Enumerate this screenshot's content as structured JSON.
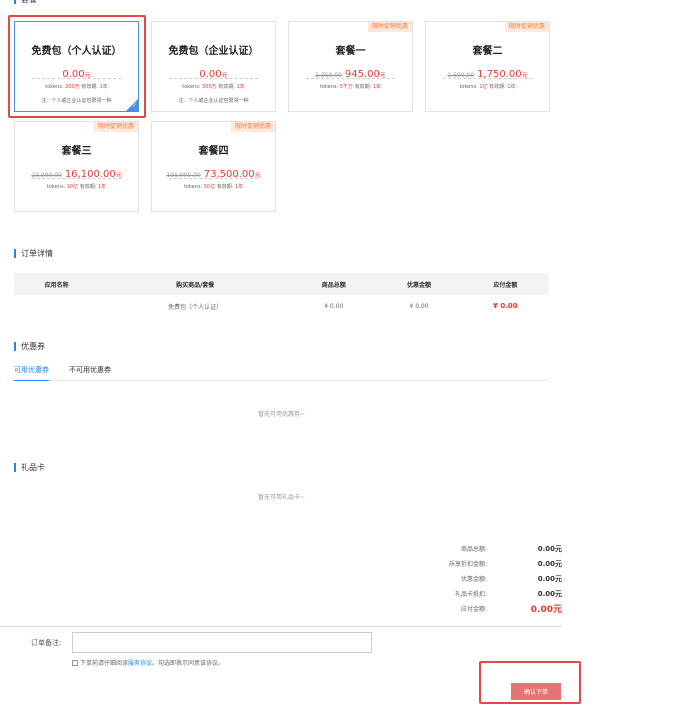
{
  "packages_section": {
    "title": "套餐"
  },
  "packages": [
    {
      "name": "免费包（个人认证）",
      "old_price": "",
      "price": "0.00",
      "unit": "元",
      "tokens_label": "tokens:",
      "tokens": "200万",
      "validity_label": "有效期:",
      "validity": "1年",
      "note": "注：个人或企业认证包限领一种",
      "promo": "",
      "selected": true
    },
    {
      "name": "免费包（企业认证）",
      "old_price": "",
      "price": "0.00",
      "unit": "元",
      "tokens_label": "tokens:",
      "tokens": "500万",
      "validity_label": "有效期:",
      "validity": "1年",
      "note": "注：个人或企业认证包限领一种",
      "promo": "",
      "selected": false
    },
    {
      "name": "套餐一",
      "old_price": "1,350.00",
      "price": "945.00",
      "unit": "元",
      "tokens_label": "tokens:",
      "tokens": "5千万",
      "validity_label": "有效期:",
      "validity": "1年",
      "note": "",
      "promo": "限时促销优惠",
      "selected": false
    },
    {
      "name": "套餐二",
      "old_price": "2,500.00",
      "price": "1,750.00",
      "unit": "元",
      "tokens_label": "tokens:",
      "tokens": "1亿",
      "validity_label": "有效期:",
      "validity": "1年",
      "note": "",
      "promo": "限时促销优惠",
      "selected": false
    },
    {
      "name": "套餐三",
      "old_price": "23,000.00",
      "price": "16,100.00",
      "unit": "元",
      "tokens_label": "tokens:",
      "tokens": "10亿",
      "validity_label": "有效期:",
      "validity": "1年",
      "note": "",
      "promo": "限时促销优惠",
      "selected": false
    },
    {
      "name": "套餐四",
      "old_price": "105,000.00",
      "price": "73,500.00",
      "unit": "元",
      "tokens_label": "tokens:",
      "tokens": "50亿",
      "validity_label": "有效期:",
      "validity": "1年",
      "note": "",
      "promo": "限时促销优惠",
      "selected": false
    }
  ],
  "order": {
    "title": "订单详情",
    "headers": [
      "应用名称",
      "购买商品/套餐",
      "商品总额",
      "优惠金额",
      "应付金额"
    ],
    "row": [
      "",
      "免费包（个人认证）",
      "¥ 0.00",
      "¥ 0.00",
      "¥ 0.00"
    ]
  },
  "coupons": {
    "title": "优惠券",
    "tab_available": "可用优惠券",
    "tab_unavailable": "不可用优惠券",
    "empty": "暂无可用优惠券~"
  },
  "giftcard": {
    "title": "礼品卡",
    "empty": "暂无可用礼品卡~"
  },
  "summary": [
    {
      "label": "商品总额:",
      "value": "0.00元"
    },
    {
      "label": "乐享折扣金额:",
      "value": "0.00元"
    },
    {
      "label": "优惠金额:",
      "value": "0.00元"
    },
    {
      "label": "礼品卡抵扣:",
      "value": "0.00元"
    },
    {
      "label": "应付金额:",
      "value": "0.00元"
    }
  ],
  "remark": {
    "label": "订单备注:",
    "value": "",
    "placeholder": ""
  },
  "agreement": {
    "prefix": "下单前请仔细阅读",
    "link": "服务协议",
    "suffix": "。勾选即表示同意该协议。"
  },
  "confirm_button": "确认下单",
  "colors": {
    "accent": "#1e88e5",
    "price_red": "#e53935",
    "highlight_box": "#e0494a",
    "confirm_bg": "#e57373",
    "promo_bg": "#fde8dc"
  }
}
